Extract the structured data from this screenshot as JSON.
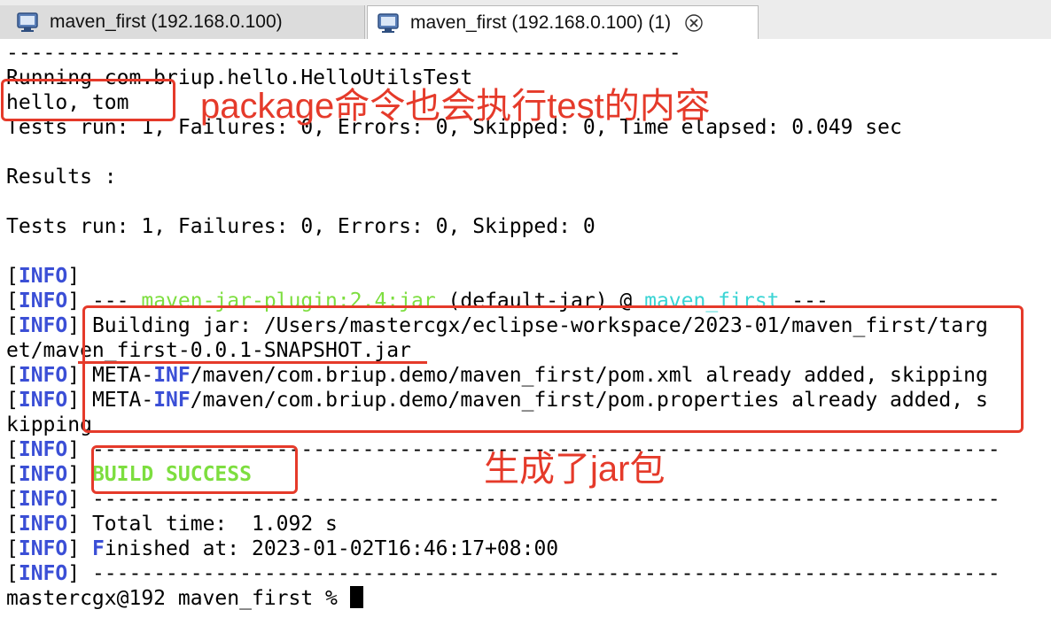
{
  "tabs": [
    {
      "label": "maven_first (192.168.0.100)",
      "active": false
    },
    {
      "label": "maven_first (192.168.0.100) (1)",
      "active": true
    }
  ],
  "terminal": {
    "separator": "-------------------------------------------------------",
    "running": "Running com.briup.hello.HelloUtilsTest",
    "hello": "hello, tom",
    "tests_run_timing": "Tests run: 1, Failures: 0, Errors: 0, Skipped: 0, Time elapsed: 0.049 sec",
    "results": "Results :",
    "tests_summary": "Tests run: 1, Failures: 0, Errors: 0, Skipped: 0",
    "info_tag": "INFO",
    "plugin_prefix": "--- ",
    "plugin_name": "maven-jar-plugin:2.4:jar",
    "plugin_goal": " (default-jar) @ ",
    "plugin_project": "maven_first",
    "plugin_suffix": " ---",
    "building_jar": " Building jar: /Users/mastercgx/eclipse-workspace/2023-01/maven_first/targ",
    "jar_cont": "et/maven_first-0.0.1-SNAPSHOT.jar",
    "meta_a1": " META-",
    "meta_inf": "INF",
    "meta_a2": "/maven/com.briup.demo/maven_first/pom.xml already added, skipping",
    "meta_b2": "/maven/com.briup.demo/maven_first/pom.properties already added, s",
    "skipping_cont": "kipping",
    "long_sep": " --------------------------------------------------------------------------",
    "build_success": "BUILD SUCCESS",
    "total_time": " Total time:  1.092 s",
    "finished_f": "F",
    "finished_rest": "inished at: 2023-01-02T16:46:17+08:00",
    "prompt": "mastercgx@192 maven_first % "
  },
  "annotations": {
    "test_note": "package命令也会执行test的内容",
    "jar_note": "生成了jar包"
  },
  "colors": {
    "annotation": "#e53a2a",
    "info": "#3b4fd6",
    "success": "#7dde3f",
    "project": "#3ad4d4"
  }
}
